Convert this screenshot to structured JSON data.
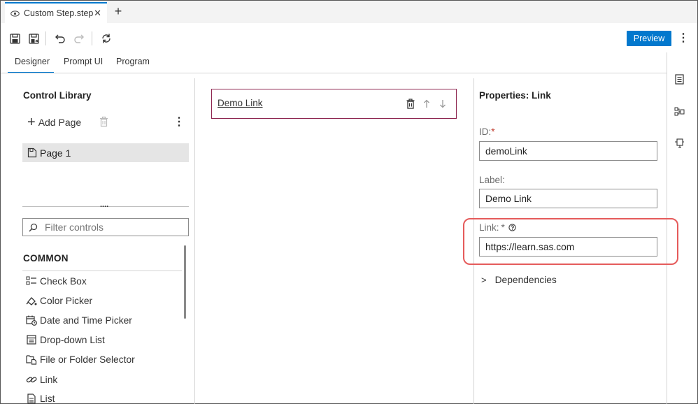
{
  "file_tab": {
    "title": "Custom Step.step",
    "close": "✕",
    "new_tab": "+"
  },
  "toolbar": {
    "preview_label": "Preview",
    "more": "⋮"
  },
  "view_tabs": [
    {
      "label": "Designer",
      "active": true
    },
    {
      "label": "Prompt UI",
      "active": false
    },
    {
      "label": "Program",
      "active": false
    }
  ],
  "control_library": {
    "title": "Control Library",
    "add_page_label": "Add Page",
    "pages": [
      "Page 1"
    ],
    "filter_placeholder": "Filter controls",
    "section_common": "COMMON",
    "controls": [
      "Check Box",
      "Color Picker",
      "Date and Time Picker",
      "Drop-down List",
      "File or Folder Selector",
      "Link",
      "List"
    ]
  },
  "canvas": {
    "link_text": "Demo Link"
  },
  "properties": {
    "title": "Properties: Link",
    "id_label": "ID:",
    "id_value": "demoLink",
    "label_label": "Label:",
    "label_value": "Demo Link",
    "link_label": "Link:",
    "required_mark": "*",
    "link_value": "https://learn.sas.com",
    "dependencies_label": "Dependencies"
  },
  "colors": {
    "accent": "#0378cd",
    "selection_border": "#8e2650",
    "highlight": "#e55b5b"
  }
}
